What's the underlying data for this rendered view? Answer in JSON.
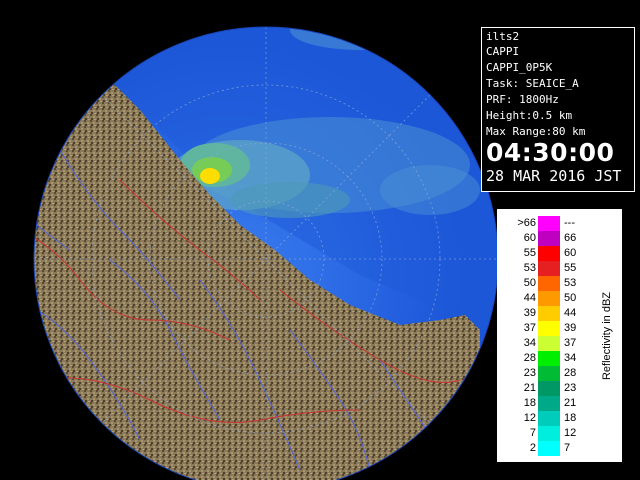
{
  "info": {
    "station": "ilts2",
    "product": "CAPPI",
    "product_id": "CAPPI_0P5K",
    "task": "Task: SEAICE_A",
    "prf": "PRF: 1800Hz",
    "height": "Height:0.5 km",
    "max_range": "Max Range:80 km",
    "time": "04:30:00",
    "date": "28 MAR 2016 JST"
  },
  "legend": {
    "unit_label": "Reflectivity in dBZ",
    "rows": [
      {
        "low": ">66",
        "high": "---",
        "color": "#ff00ff"
      },
      {
        "low": "60",
        "high": "66",
        "color": "#c000c0"
      },
      {
        "low": "55",
        "high": "60",
        "color": "#ff0000"
      },
      {
        "low": "53",
        "high": "55",
        "color": "#e62020"
      },
      {
        "low": "50",
        "high": "53",
        "color": "#ff6600"
      },
      {
        "low": "44",
        "high": "50",
        "color": "#ff9900"
      },
      {
        "low": "39",
        "high": "44",
        "color": "#ffcc00"
      },
      {
        "low": "37",
        "high": "39",
        "color": "#ffff00"
      },
      {
        "low": "34",
        "high": "37",
        "color": "#ccff33"
      },
      {
        "low": "28",
        "high": "34",
        "color": "#00ee00"
      },
      {
        "low": "23",
        "high": "28",
        "color": "#00bb33"
      },
      {
        "low": "21",
        "high": "23",
        "color": "#009966"
      },
      {
        "low": "18",
        "high": "21",
        "color": "#00aa88"
      },
      {
        "low": "12",
        "high": "18",
        "color": "#00ccbb"
      },
      {
        "low": "7",
        "high": "12",
        "color": "#00eedd"
      },
      {
        "low": "2",
        "high": "7",
        "color": "#00ffff"
      }
    ]
  },
  "map_colors": {
    "background": "#000000",
    "sea_far": "#1a4fd6",
    "sea_near": "#2f6fe8",
    "land": "#8a7a5a",
    "land_dark": "#5a4a32",
    "rivers": "#5566dd",
    "borders": "#cc3333",
    "range_rings": "#7f9fcf"
  }
}
